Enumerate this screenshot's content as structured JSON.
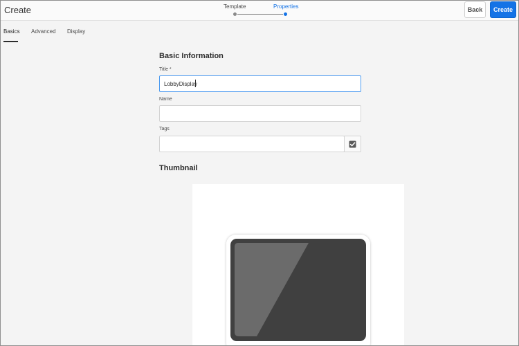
{
  "header": {
    "title": "Create",
    "steps": [
      {
        "label": "Template",
        "state": "done"
      },
      {
        "label": "Properties",
        "state": "active"
      }
    ],
    "back_label": "Back",
    "create_label": "Create"
  },
  "tabs": [
    {
      "label": "Basics",
      "active": true
    },
    {
      "label": "Advanced",
      "active": false
    },
    {
      "label": "Display",
      "active": false
    }
  ],
  "form": {
    "section_title": "Basic Information",
    "title_label": "Title *",
    "title_value": "LobbyDisplay",
    "name_label": "Name",
    "name_value": "",
    "tags_label": "Tags",
    "tags_value": "",
    "tags_icon": "checkbox-checked-icon"
  },
  "thumbnail": {
    "section_title": "Thumbnail",
    "icon": "display-device-icon"
  },
  "colors": {
    "accent": "#1473e6",
    "device_body": "#404040",
    "device_glare": "#6b6b6b"
  }
}
